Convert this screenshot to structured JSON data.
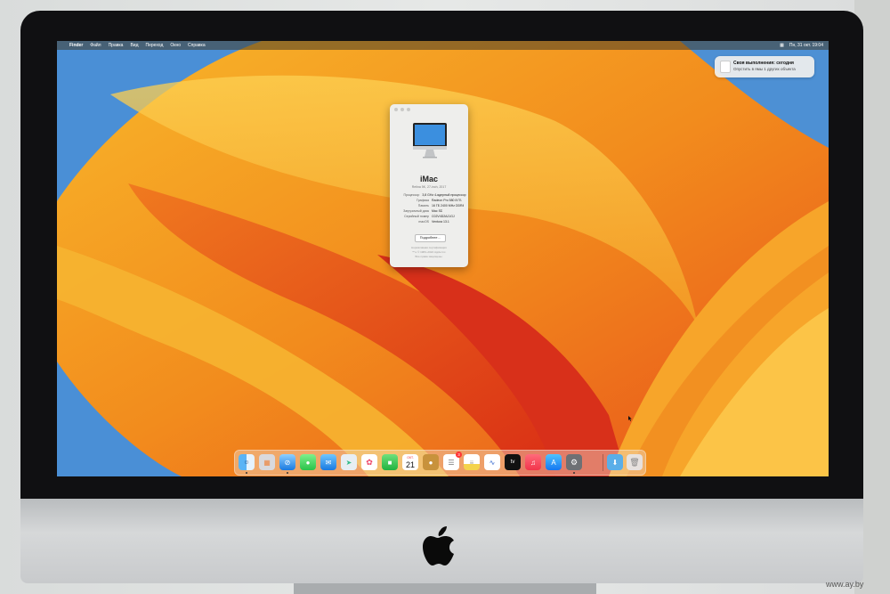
{
  "menubar": {
    "apple": "",
    "app_name": "Finder",
    "items": [
      "Файл",
      "Правка",
      "Вид",
      "Переход",
      "Окно",
      "Справка"
    ],
    "right_status": "Пн, 31 окт. 19:04"
  },
  "notification": {
    "title": "Своя выполнения: сегодня",
    "body": "Опустить в ямы 1 других объекта"
  },
  "about_window": {
    "model": "iMac",
    "variant": "Retina 5K, 27-inch, 2017",
    "specs": [
      {
        "key": "Процессор",
        "value": "3,8 GHz 4-ядерный процессор Intel Core i5"
      },
      {
        "key": "Графика",
        "value": "Radeon Pro 580 8 ГБ"
      },
      {
        "key": "Память",
        "value": "16 ГБ 2400 MHz DDR4"
      },
      {
        "key": "Загрузочный диск",
        "value": "Mac SD"
      },
      {
        "key": "Серийный номер",
        "value": "C02V4D2AJ1GJ"
      },
      {
        "key": "macOS",
        "value": "Ventura 13.1"
      }
    ],
    "details_button": "Подробнее…",
    "legal_1": "Нормативная сертификация",
    "legal_2": "™ и © 1983–2022 Apple Inc.",
    "legal_3": "Все права защищены."
  },
  "dock": {
    "calendar_month": "ОКТ.",
    "calendar_day": "21",
    "reminders_badge": "3",
    "tv_label": "tv"
  },
  "watermark": "www.ay.by",
  "colors": {
    "wallpaper_orange": "#f7a21c",
    "wallpaper_red": "#e2391b",
    "wallpaper_blue": "#4a8fd6",
    "bezel": "#101012",
    "chin": "#c8cacc"
  }
}
